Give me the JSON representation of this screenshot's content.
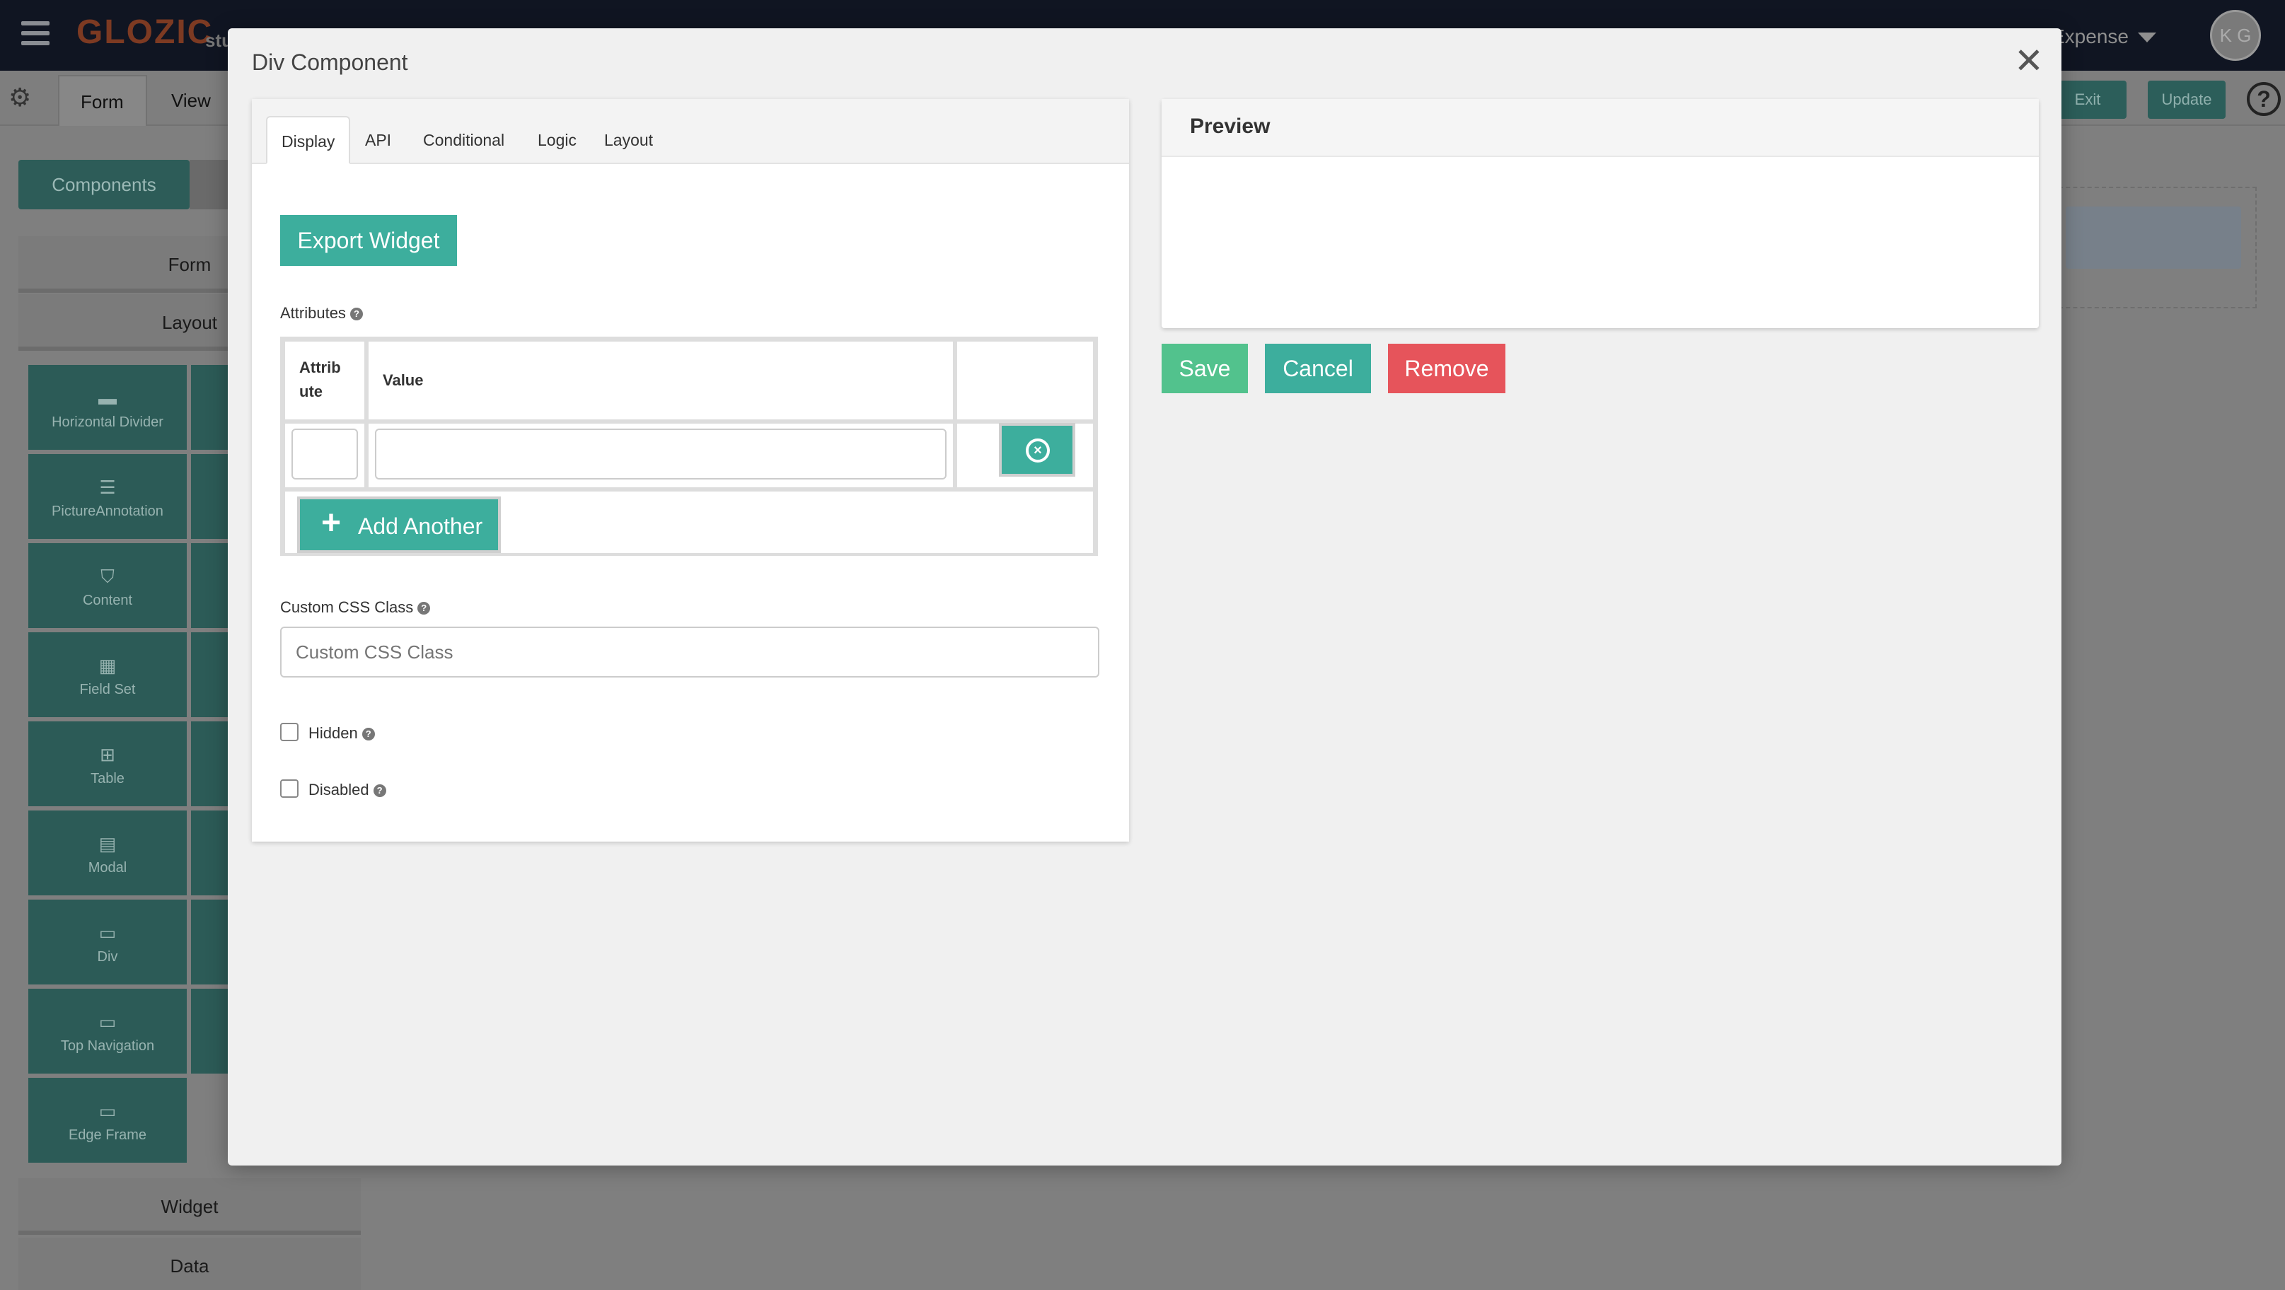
{
  "app": {
    "logo": "GLOZIC",
    "logo_sub": "stu",
    "app_name": "Expense",
    "avatar_initials": "K G"
  },
  "subbar": {
    "tabs": [
      "Form",
      "View"
    ],
    "exit_label": "Exit",
    "update_label": "Update",
    "help_label": "?"
  },
  "sidebar": {
    "components_label": "Components",
    "sections": [
      "Form",
      "Layout",
      "Widget",
      "Data"
    ],
    "layout_items": [
      {
        "label": "Horizontal Divider",
        "icon": "minus-icon"
      },
      {
        "label": "PictureAnnotation",
        "icon": "lines-icon"
      },
      {
        "label": "Content",
        "icon": "html5-icon"
      },
      {
        "label": "Field Set",
        "icon": "grid-icon"
      },
      {
        "label": "Table",
        "icon": "table-icon"
      },
      {
        "label": "Modal",
        "icon": "modal-icon"
      },
      {
        "label": "Div",
        "icon": "card-icon"
      },
      {
        "label": "Top Navigation",
        "icon": "card-icon"
      },
      {
        "label": "Edge Frame",
        "icon": "card-icon"
      }
    ]
  },
  "modal": {
    "title": "Div Component",
    "close_symbol": "✕",
    "tabs": [
      "Display",
      "API",
      "Conditional",
      "Logic",
      "Layout"
    ],
    "active_tab": "Display",
    "export_label": "Export Widget",
    "attributes_label": "Attributes",
    "table": {
      "col_attribute_line1": "Attrib",
      "col_attribute_line2": "ute",
      "col_value": "Value",
      "row_attribute_value": "",
      "row_value_value": "",
      "add_another_label": "Add Another",
      "add_plus": "+"
    },
    "css_class_label": "Custom CSS Class",
    "css_class_placeholder": "Custom CSS Class",
    "hidden_label": "Hidden",
    "disabled_label": "Disabled",
    "hidden_checked": false,
    "disabled_checked": false,
    "preview_title": "Preview",
    "save_label": "Save",
    "cancel_label": "Cancel",
    "remove_label": "Remove"
  },
  "colors": {
    "accent": "#3dae9d",
    "save": "#52c28d",
    "remove": "#e6545b",
    "topbar": "#101522"
  }
}
